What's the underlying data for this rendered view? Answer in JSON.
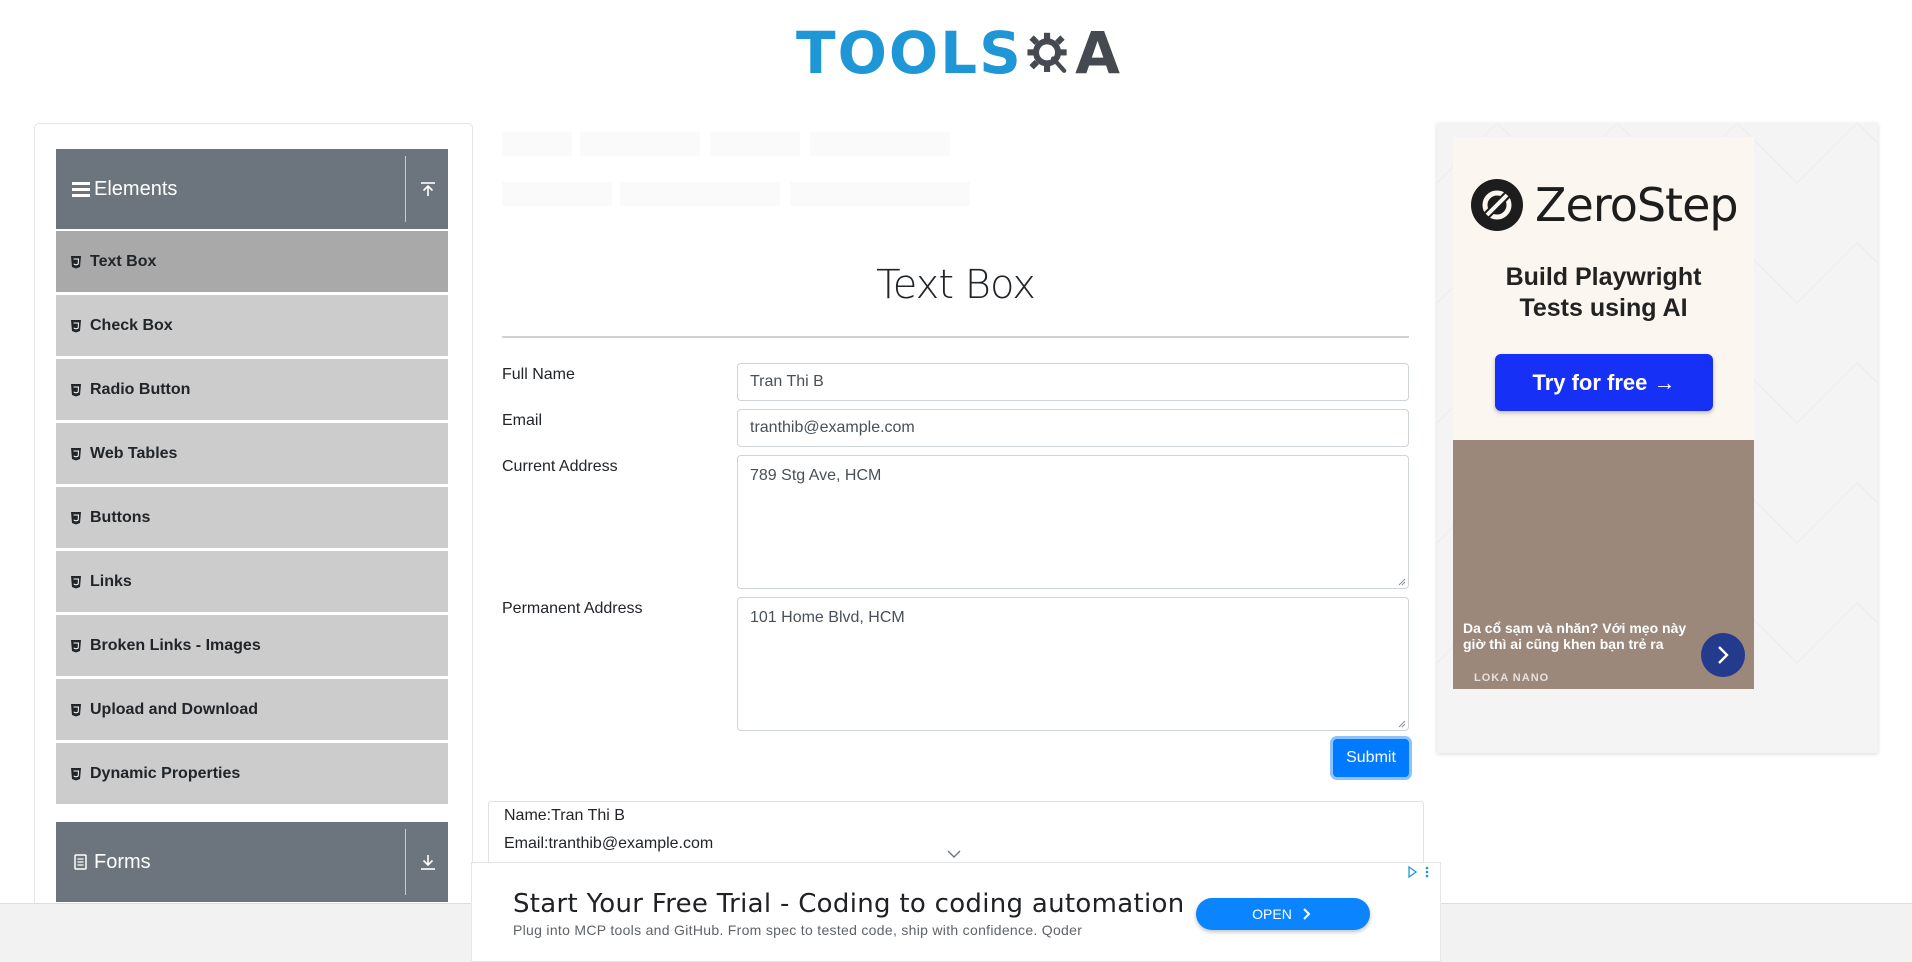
{
  "header": {
    "logo_text_left": "TOOLS",
    "logo_text_right": "A",
    "logo_colors": {
      "tools": "#1f97d6",
      "gear": "#444a50"
    }
  },
  "sidebar": {
    "groups": [
      {
        "label": "Elements",
        "icon": "hamburger-icon",
        "toggle_icon": "upload-icon"
      },
      {
        "label": "Forms",
        "icon": "document-icon",
        "toggle_icon": "download-icon"
      }
    ],
    "items": [
      {
        "label": "Text Box",
        "active": true
      },
      {
        "label": "Check Box"
      },
      {
        "label": "Radio Button"
      },
      {
        "label": "Web Tables"
      },
      {
        "label": "Buttons"
      },
      {
        "label": "Links"
      },
      {
        "label": "Broken Links - Images"
      },
      {
        "label": "Upload and Download"
      },
      {
        "label": "Dynamic Properties"
      }
    ],
    "colors": {
      "header": "#6c757d",
      "item": "#cccccc",
      "active_item": "#a9a9a9"
    }
  },
  "main": {
    "title": "Text Box",
    "form": {
      "full_name": {
        "label": "Full Name",
        "value": "Tran Thi B"
      },
      "email": {
        "label": "Email",
        "value": "tranthib@example.com"
      },
      "current_address": {
        "label": "Current Address",
        "value": "789 Stg Ave, HCM"
      },
      "permanent_address": {
        "label": "Permanent Address",
        "value": "101 Home Blvd, HCM"
      },
      "submit_label": "Submit"
    },
    "output": {
      "name_line": "Name:Tran Thi B",
      "email_line": "Email:tranthib@example.com"
    },
    "accent_color": "#007bff"
  },
  "right_ad": {
    "brand": "ZeroStep",
    "tagline_line1": "Build Playwright",
    "tagline_line2": "Tests using AI",
    "cta": "Try for free →",
    "photo_caption": "Da cổ sạm và nhăn? Với mẹo này giờ thì ai cũng khen bạn trẻ ra",
    "photo_brand": "LOKA NANO",
    "cta_color": "#1730f5"
  },
  "bottom_banner": {
    "title": "Start Your Free Trial - Coding to coding automation",
    "subtitle": "Plug into MCP tools and GitHub. From spec to tested code, ship with confidence. Qoder",
    "open_label": "OPEN",
    "open_color": "#0b84ff"
  }
}
